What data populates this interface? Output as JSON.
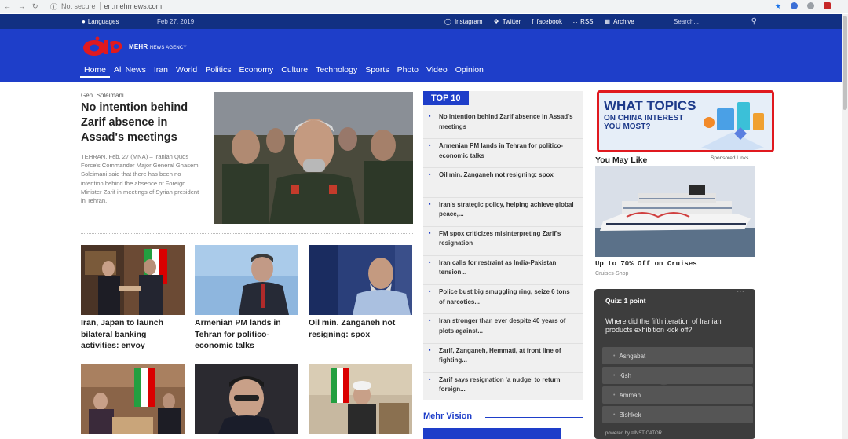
{
  "browser": {
    "security": "Not secure",
    "url": "en.mehrnews.com"
  },
  "topbar": {
    "languages": "Languages",
    "date": "Feb 27, 2019",
    "social": [
      "Instagram",
      "Twitter",
      "facebook",
      "RSS",
      "Archive"
    ],
    "search_placeholder": "Search..."
  },
  "brand": {
    "name": "MEHR",
    "suffix": "NEWS AGENCY"
  },
  "menu": [
    "Home",
    "All News",
    "Iran",
    "World",
    "Politics",
    "Economy",
    "Culture",
    "Technology",
    "Sports",
    "Photo",
    "Video",
    "Opinion"
  ],
  "lead": {
    "kicker": "Gen. Soleimani",
    "title": "No intention behind Zarif absence in Assad's meetings",
    "text": "TEHRAN, Feb. 27 (MNA) – Iranian Quds Force's Commander Major General Ghasem Soleimani said that there has been no intention behind the absence of Foreign Minister Zarif in meetings of Syrian president in Tehran."
  },
  "stories": [
    {
      "title": "Iran, Japan to launch bilateral banking activities: envoy"
    },
    {
      "title": "Armenian PM lands in Tehran for politico-economic talks"
    },
    {
      "title": "Oil min. Zanganeh not resigning: spox"
    }
  ],
  "top10": {
    "label": "TOP 10",
    "items": [
      "No intention behind Zarif absence in Assad's meetings",
      "Armenian PM lands in Tehran for politico-economic talks",
      "Oil min. Zanganeh not resigning: spox",
      "Iran's strategic policy, helping achieve global peace,...",
      "FM spox criticizes misinterpreting Zarif's resignation",
      "Iran calls for restraint as India-Pakistan tension...",
      "Police bust big smuggling ring, seize 6 tons of narcotics...",
      "Iran stronger than ever despite 40 years of plots against...",
      "Zarif, Zanganeh, Hemmati, at front line of fighting...",
      "Zarif says resignation 'a nudge' to return foreign..."
    ]
  },
  "mehr_vision": "Mehr Vision",
  "ad": {
    "line1": "WHAT TOPICS",
    "line2": "ON CHINA INTEREST YOU MOST?"
  },
  "may_like": {
    "heading": "You May Like",
    "sponsored": "Sponsored Links",
    "promo_title": "Up to 70% Off on Cruises",
    "promo_source": "Cruises-Shop"
  },
  "quiz": {
    "header": "Quiz: 1 point",
    "question": "Where did the fifth iteration of Iranian products exhibition kick off?",
    "options": [
      "Ashgabat",
      "Kish",
      "Amman",
      "Bishkek"
    ],
    "powered": "powered by  ≡INSTICATOR"
  },
  "colors": {
    "brand_blue": "#1e3ec9",
    "topbar_blue": "#123082",
    "logo_red": "#e0191f"
  }
}
